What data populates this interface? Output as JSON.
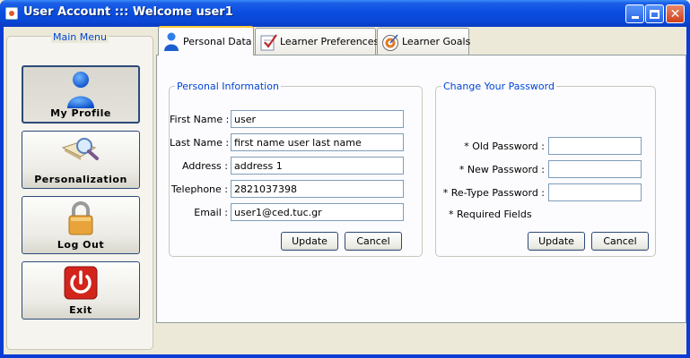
{
  "window": {
    "title": "User Account ::: Welcome user1"
  },
  "main_menu": {
    "legend": "Main Menu",
    "items": [
      {
        "label": "My Profile",
        "icon": "user-icon",
        "active": true
      },
      {
        "label": "Personalization",
        "icon": "magnifier-document-icon",
        "active": false
      },
      {
        "label": "Log Out",
        "icon": "padlock-icon",
        "active": false
      },
      {
        "label": "Exit",
        "icon": "power-icon",
        "active": false
      }
    ]
  },
  "tabs": [
    {
      "label": "Personal Data",
      "icon": "user-icon",
      "active": true
    },
    {
      "label": "Learner Preferences",
      "icon": "checklist-icon",
      "active": false
    },
    {
      "label": "Learner Goals",
      "icon": "target-icon",
      "active": false
    }
  ],
  "personal_info": {
    "legend": "Personal Information",
    "fields": [
      {
        "label": "First Name :",
        "value": "user"
      },
      {
        "label": "Last Name :",
        "value": "first name user last name"
      },
      {
        "label": "Address :",
        "value": "address 1"
      },
      {
        "label": "Telephone :",
        "value": "2821037398"
      },
      {
        "label": "Email :",
        "value": "user1@ced.tuc.gr"
      }
    ],
    "update_label": "Update",
    "cancel_label": "Cancel"
  },
  "change_password": {
    "legend": "Change Your Password",
    "fields": [
      {
        "label": "* Old Password :",
        "value": ""
      },
      {
        "label": "* New Password :",
        "value": ""
      },
      {
        "label": "* Re-Type Password :",
        "value": ""
      }
    ],
    "required_note": "* Required Fields",
    "update_label": "Update",
    "cancel_label": "Cancel"
  },
  "colors": {
    "titlebar": "#0a4ee0",
    "legend_text": "#0046d5",
    "tab_highlight": "#ffc83c"
  }
}
